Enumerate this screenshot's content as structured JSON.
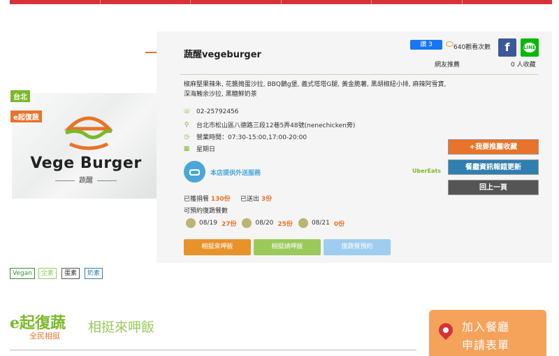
{
  "restaurant": {
    "name": "蔬醒vegeburger",
    "region_tag": "台北",
    "program_tag": "e起復蔬",
    "logo_text": "Vege Burger",
    "logo_sub": "蔬醒",
    "menu_text": "椒麻堅果辣朱, 花醬搗蛋沙拉, BBQ鵝g堡, 義式塔塔G腿, 黃金脆薯, 黑胡椒紐小排, 麻辣阿雪寶, 深海鮪余沙拉, 黑糖鮮奶茶",
    "phone": "02-25792456",
    "address": "台北市松山區八德路三段12巷5弄48號(nenechicken旁)",
    "hours": "營業時間：07:30-15:00,17:00-20:00",
    "closed": "星期日"
  },
  "social": {
    "fb_like": "讚 3",
    "views": "640觀看次數",
    "recommend_label": "網友推薦",
    "favorites": "0 人收藏"
  },
  "delivery": {
    "label": "本店提供外送服務",
    "platform": "UberEats"
  },
  "actions": {
    "recommend_btn": "+我要推薦收藏",
    "report_btn": "餐廳資訊報錯更新",
    "back_btn": "回上一頁"
  },
  "donations": {
    "donated_label": "已獲捐餐",
    "donated_value": "130份",
    "sent_label": "已送出",
    "sent_value": "3份",
    "bookable_label": "可預約復蔬餐數",
    "dates": [
      {
        "date": "08/19",
        "count": "27份"
      },
      {
        "date": "08/20",
        "count": "25份"
      },
      {
        "date": "08/21",
        "count": "0份"
      }
    ]
  },
  "cta_buttons": {
    "b1": "相挺來呷飯",
    "b2": "相挺請呷飯",
    "b3": "復蔬餐預約"
  },
  "diet_tags": [
    "Vegan",
    "全素",
    "蛋素",
    "奶素"
  ],
  "footer": {
    "brand": "e起復蔬",
    "brand_sub": "全民相挺",
    "slogan": "相挺來呷飯",
    "join_line1": "加入餐廳",
    "join_line2": "申請表單"
  },
  "colors": {
    "accent_orange": "#e8732a",
    "accent_green": "#7ab928",
    "accent_blue": "#2f7fb0",
    "nav_red": "#d7323a"
  }
}
